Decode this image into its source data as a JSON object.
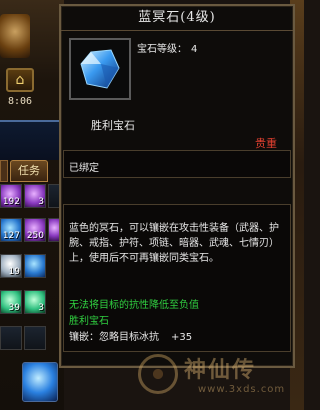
{
  "hud": {
    "clock": "8:06",
    "task_tab": "任务",
    "inventory_counts": [
      "192",
      "3",
      "127",
      "250",
      "19",
      "39",
      "3"
    ]
  },
  "tooltip": {
    "title": "蓝冥石",
    "title_level": "(4级)",
    "level_label": "宝石等级：",
    "level_value": "4",
    "subtitle": "胜利宝石",
    "rarity": "贵重",
    "bound": "已绑定",
    "description": "蓝色的冥石，可以镶嵌在攻击性装备（武器、护腕、戒指、护符、项链、暗器、武魂、七情刃）上，使用后不可再镶嵌同类宝石。",
    "effect_line": "无法将目标的抗性降低至负值",
    "set_name": "胜利宝石",
    "inlay_label": "镶嵌：忽略目标冰抗",
    "inlay_value": "+35"
  },
  "watermark": {
    "text": "神仙传",
    "url": "www.3xds.com"
  },
  "colors": {
    "rarity": "#e04030",
    "effect_green": "#30d040",
    "text_white": "#e8e8e8"
  }
}
